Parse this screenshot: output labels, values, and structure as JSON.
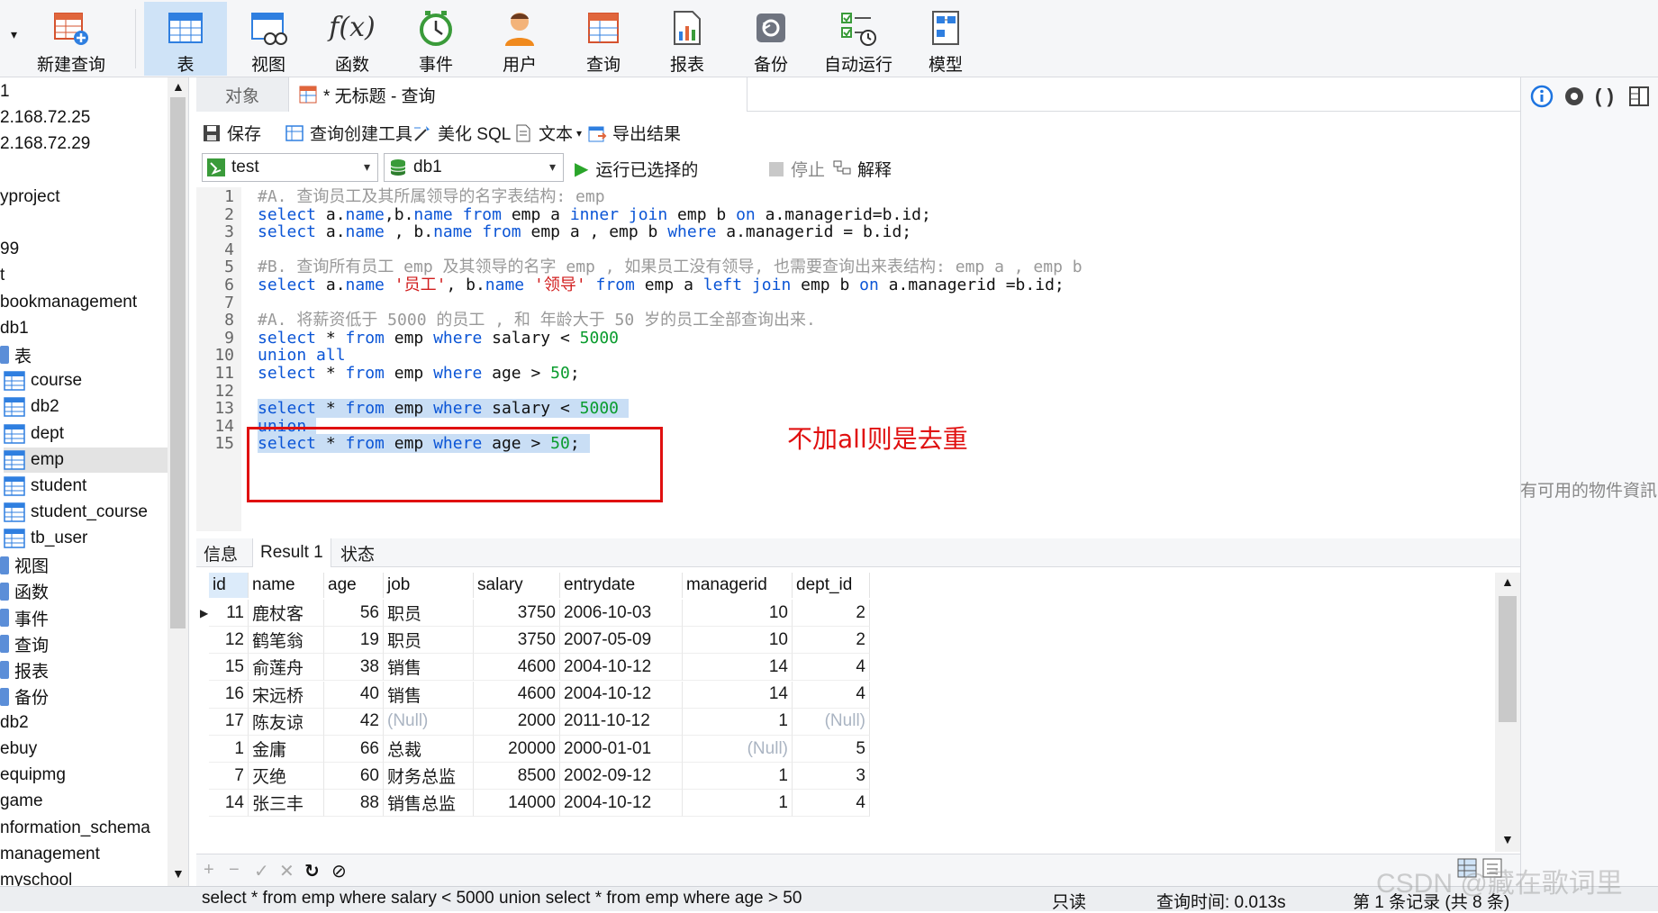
{
  "toolbar": {
    "buttons": [
      {
        "label": "新建查询",
        "icon": "new-query-icon"
      },
      {
        "label": "表",
        "icon": "table-icon"
      },
      {
        "label": "视图",
        "icon": "view-icon"
      },
      {
        "label": "函数",
        "icon": "function-icon"
      },
      {
        "label": "事件",
        "icon": "event-icon"
      },
      {
        "label": "用户",
        "icon": "user-icon"
      },
      {
        "label": "查询",
        "icon": "query-icon"
      },
      {
        "label": "报表",
        "icon": "report-icon"
      },
      {
        "label": "备份",
        "icon": "backup-icon"
      },
      {
        "label": "自动运行",
        "icon": "automation-icon"
      },
      {
        "label": "模型",
        "icon": "model-icon"
      }
    ],
    "function_glyph": "f(x)"
  },
  "nav": {
    "items": [
      {
        "label": "1"
      },
      {
        "label": "2.168.72.25"
      },
      {
        "label": "2.168.72.29"
      },
      {
        "label": ""
      },
      {
        "label": "yproject"
      },
      {
        "label": ""
      },
      {
        "label": "99"
      },
      {
        "label": "t"
      },
      {
        "label": "bookmanagement"
      },
      {
        "label": "db1"
      },
      {
        "label": "表"
      },
      {
        "label": "course"
      },
      {
        "label": "db2"
      },
      {
        "label": "dept"
      },
      {
        "label": "emp"
      },
      {
        "label": "student"
      },
      {
        "label": "student_course"
      },
      {
        "label": "tb_user"
      },
      {
        "label": "视图"
      },
      {
        "label": "函数"
      },
      {
        "label": "事件"
      },
      {
        "label": "查询"
      },
      {
        "label": "报表"
      },
      {
        "label": "备份"
      },
      {
        "label": "db2"
      },
      {
        "label": "ebuy"
      },
      {
        "label": "equipmg"
      },
      {
        "label": "game"
      },
      {
        "label": "nformation_schema"
      },
      {
        "label": "management"
      },
      {
        "label": "myschool"
      }
    ]
  },
  "tabs": {
    "objects": "对象",
    "query": "* 无标题 - 查询"
  },
  "query_toolbar": {
    "save": "保存",
    "builder": "查询创建工具",
    "beautify": "美化 SQL",
    "text": "文本",
    "export": "导出结果",
    "run_selected": "运行已选择的",
    "stop": "停止",
    "explain": "解释"
  },
  "connection": {
    "value": "test"
  },
  "database": {
    "value": "db1"
  },
  "editor": {
    "line_numbers": [
      "1",
      "2",
      "3",
      "4",
      "5",
      "6",
      "7",
      "8",
      "9",
      "10",
      "11",
      "12",
      "13",
      "14",
      "15"
    ],
    "lines": [
      [
        {
          "t": "cm",
          "s": "#A. 查询员工及其所属领导的名字表结构: emp"
        }
      ],
      [
        {
          "t": "kw",
          "s": "select"
        },
        {
          "t": "tx",
          "s": " a."
        },
        {
          "t": "kw",
          "s": "name"
        },
        {
          "t": "tx",
          "s": ",b."
        },
        {
          "t": "kw",
          "s": "name"
        },
        {
          "t": "tx",
          "s": " "
        },
        {
          "t": "kw",
          "s": "from"
        },
        {
          "t": "tx",
          "s": " emp a "
        },
        {
          "t": "kw",
          "s": "inner join"
        },
        {
          "t": "tx",
          "s": " emp b "
        },
        {
          "t": "kw",
          "s": "on"
        },
        {
          "t": "tx",
          "s": " a.managerid=b.id;"
        }
      ],
      [
        {
          "t": "kw",
          "s": "select"
        },
        {
          "t": "tx",
          "s": " a."
        },
        {
          "t": "kw",
          "s": "name"
        },
        {
          "t": "tx",
          "s": " , b."
        },
        {
          "t": "kw",
          "s": "name"
        },
        {
          "t": "tx",
          "s": " "
        },
        {
          "t": "kw",
          "s": "from"
        },
        {
          "t": "tx",
          "s": " emp a , emp b "
        },
        {
          "t": "kw",
          "s": "where"
        },
        {
          "t": "tx",
          "s": " a.managerid = b.id;"
        }
      ],
      [],
      [
        {
          "t": "cm",
          "s": "#B. 查询所有员工 emp 及其领导的名字 emp , 如果员工没有领导, 也需要查询出来表结构: emp a , emp b"
        }
      ],
      [
        {
          "t": "kw",
          "s": "select"
        },
        {
          "t": "tx",
          "s": " a."
        },
        {
          "t": "kw",
          "s": "name"
        },
        {
          "t": "tx",
          "s": " "
        },
        {
          "t": "str",
          "s": "'员工'"
        },
        {
          "t": "tx",
          "s": ", b."
        },
        {
          "t": "kw",
          "s": "name"
        },
        {
          "t": "tx",
          "s": " "
        },
        {
          "t": "str",
          "s": "'领导'"
        },
        {
          "t": "tx",
          "s": " "
        },
        {
          "t": "kw",
          "s": "from"
        },
        {
          "t": "tx",
          "s": " emp a "
        },
        {
          "t": "kw",
          "s": "left join"
        },
        {
          "t": "tx",
          "s": " emp b "
        },
        {
          "t": "kw",
          "s": "on"
        },
        {
          "t": "tx",
          "s": " a.managerid =b.id;"
        }
      ],
      [],
      [
        {
          "t": "cm",
          "s": "#A. 将薪资低于 5000 的员工 , 和 年龄大于 50 岁的员工全部查询出来."
        }
      ],
      [
        {
          "t": "kw",
          "s": "select"
        },
        {
          "t": "tx",
          "s": " * "
        },
        {
          "t": "kw",
          "s": "from"
        },
        {
          "t": "tx",
          "s": " emp "
        },
        {
          "t": "kw",
          "s": "where"
        },
        {
          "t": "tx",
          "s": " salary < "
        },
        {
          "t": "num",
          "s": "5000"
        }
      ],
      [
        {
          "t": "kw",
          "s": "union all"
        }
      ],
      [
        {
          "t": "kw",
          "s": "select"
        },
        {
          "t": "tx",
          "s": " * "
        },
        {
          "t": "kw",
          "s": "from"
        },
        {
          "t": "tx",
          "s": " emp "
        },
        {
          "t": "kw",
          "s": "where"
        },
        {
          "t": "tx",
          "s": " age > "
        },
        {
          "t": "num",
          "s": "50"
        },
        {
          "t": "tx",
          "s": ";"
        }
      ],
      [],
      [
        {
          "t": "kw",
          "s": "select"
        },
        {
          "t": "tx",
          "s": " * "
        },
        {
          "t": "kw",
          "s": "from"
        },
        {
          "t": "tx",
          "s": " emp "
        },
        {
          "t": "kw",
          "s": "where"
        },
        {
          "t": "tx",
          "s": " salary < "
        },
        {
          "t": "num",
          "s": "5000"
        },
        {
          "t": "tx",
          "s": " "
        }
      ],
      [
        {
          "t": "kw",
          "s": "union"
        },
        {
          "t": "tx",
          "s": " "
        }
      ],
      [
        {
          "t": "kw",
          "s": "select"
        },
        {
          "t": "tx",
          "s": " * "
        },
        {
          "t": "kw",
          "s": "from"
        },
        {
          "t": "tx",
          "s": " emp "
        },
        {
          "t": "kw",
          "s": "where"
        },
        {
          "t": "tx",
          "s": " age > "
        },
        {
          "t": "num",
          "s": "50"
        },
        {
          "t": "tx",
          "s": "; "
        }
      ]
    ],
    "selected_lines": [
      13,
      14,
      15
    ],
    "annotation": "不加all则是去重"
  },
  "right_panel": {
    "hint": "有可用的物件資訊"
  },
  "result_tabs": [
    "信息",
    "Result 1",
    "状态"
  ],
  "grid": {
    "columns": [
      "id",
      "name",
      "age",
      "job",
      "salary",
      "entrydate",
      "managerid",
      "dept_id"
    ],
    "rows": [
      [
        "11",
        "鹿杖客",
        "56",
        "职员",
        "3750",
        "2006-10-03",
        "10",
        "2"
      ],
      [
        "12",
        "鹤笔翁",
        "19",
        "职员",
        "3750",
        "2007-05-09",
        "10",
        "2"
      ],
      [
        "15",
        "俞莲舟",
        "38",
        "销售",
        "4600",
        "2004-10-12",
        "14",
        "4"
      ],
      [
        "16",
        "宋远桥",
        "40",
        "销售",
        "4600",
        "2004-10-12",
        "14",
        "4"
      ],
      [
        "17",
        "陈友谅",
        "42",
        "(Null)",
        "2000",
        "2011-10-12",
        "1",
        "(Null)"
      ],
      [
        "1",
        "金庸",
        "66",
        "总裁",
        "20000",
        "2000-01-01",
        "(Null)",
        "5"
      ],
      [
        "7",
        "灭绝",
        "60",
        "财务总监",
        "8500",
        "2002-09-12",
        "1",
        "3"
      ],
      [
        "14",
        "张三丰",
        "88",
        "销售总监",
        "14000",
        "2004-10-12",
        "1",
        "4"
      ]
    ]
  },
  "status": {
    "sql": "select * from emp where salary < 5000 union select * from emp where age > 50",
    "readonly": "只读",
    "query_time": "查询时间: 0.013s",
    "records": "第 1 条记录 (共 8 条)"
  },
  "watermark": "CSDN @藏在歌词里"
}
